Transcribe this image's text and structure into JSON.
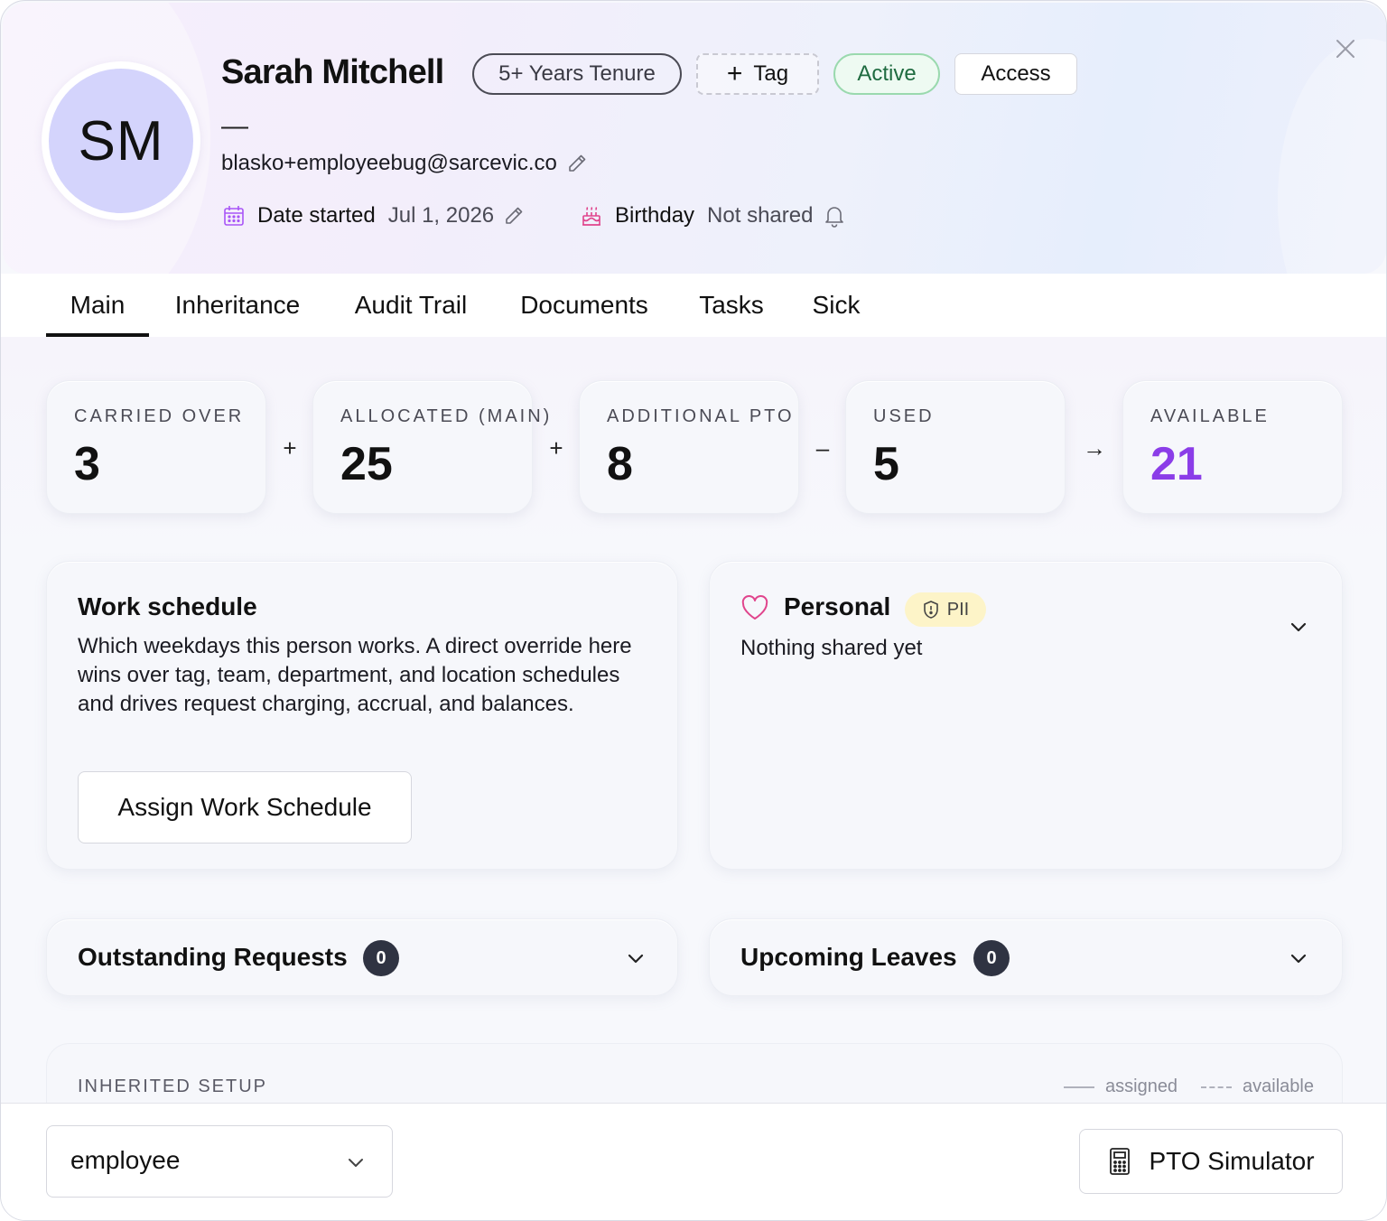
{
  "header": {
    "initials": "SM",
    "name": "Sarah Mitchell",
    "tenure_badge": "5+ Years Tenure",
    "tag_button": "Tag",
    "status_badge": "Active",
    "access_button": "Access",
    "subtitle_dash": "—",
    "email": "blasko+employeebug@sarcevic.co",
    "date_started_label": "Date started",
    "date_started_value": "Jul 1, 2026",
    "birthday_label": "Birthday",
    "birthday_value": "Not shared"
  },
  "tabs": [
    {
      "label": "Main",
      "selected": true
    },
    {
      "label": "Inheritance",
      "selected": false
    },
    {
      "label": "Audit Trail",
      "selected": false
    },
    {
      "label": "Documents",
      "selected": false
    },
    {
      "label": "Tasks",
      "selected": false
    },
    {
      "label": "Sick",
      "selected": false
    }
  ],
  "balance": {
    "carried_over": {
      "label": "CARRIED OVER",
      "value": "3"
    },
    "allocated": {
      "label": "ALLOCATED (MAIN)",
      "value": "25"
    },
    "additional": {
      "label": "ADDITIONAL PTO",
      "value": "8"
    },
    "used": {
      "label": "USED",
      "value": "5"
    },
    "available": {
      "label": "AVAILABLE",
      "value": "21"
    },
    "operators": [
      "+",
      "+",
      "–",
      "→"
    ]
  },
  "work_schedule": {
    "title": "Work schedule",
    "description": "Which weekdays this person works. A direct override here wins over tag, team, department, and location schedules and drives request charging, accrual, and balances.",
    "assign_button": "Assign Work Schedule"
  },
  "personal": {
    "title": "Personal",
    "pii_badge": "PII",
    "empty_text": "Nothing shared yet"
  },
  "outstanding_requests": {
    "title": "Outstanding Requests",
    "count": "0"
  },
  "upcoming_leaves": {
    "title": "Upcoming Leaves",
    "count": "0"
  },
  "inherited_setup": {
    "title": "INHERITED SETUP",
    "legend_assigned": "assigned",
    "legend_available": "available"
  },
  "footer": {
    "role_select": "employee",
    "pto_simulator": "PTO Simulator"
  },
  "colors": {
    "accent_available": "#8b3de8",
    "active_green": "#1f6b40",
    "avatar_bg": "#d4d4fc",
    "pii_bg": "#fdf4c8",
    "heart_pink": "#e0448c"
  }
}
